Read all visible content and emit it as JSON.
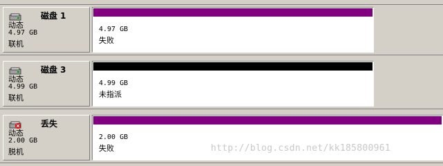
{
  "colors": {
    "failed_band": "#800080",
    "unallocated_band": "#000000"
  },
  "disks": [
    {
      "icon": "disk-icon",
      "name": "磁盘 1",
      "type": "动态",
      "size": "4.97 GB",
      "status": "联机",
      "partition": {
        "size": "4.97 GB",
        "status": "失败",
        "band": "failed"
      }
    },
    {
      "icon": "disk-icon",
      "name": "磁盘 3",
      "type": "动态",
      "size": "4.99 GB",
      "status": "联机",
      "partition": {
        "size": "4.99 GB",
        "status": "未指派",
        "band": "unallocated"
      }
    },
    {
      "icon": "missing-disk-icon",
      "name": "丢失",
      "type": "动态",
      "size": "2.00 GB",
      "status": "脱机",
      "partition": {
        "size": "2.00 GB",
        "status": "失败",
        "band": "failed"
      }
    }
  ],
  "watermark": "http://blog.csdn.net/kk185800961"
}
